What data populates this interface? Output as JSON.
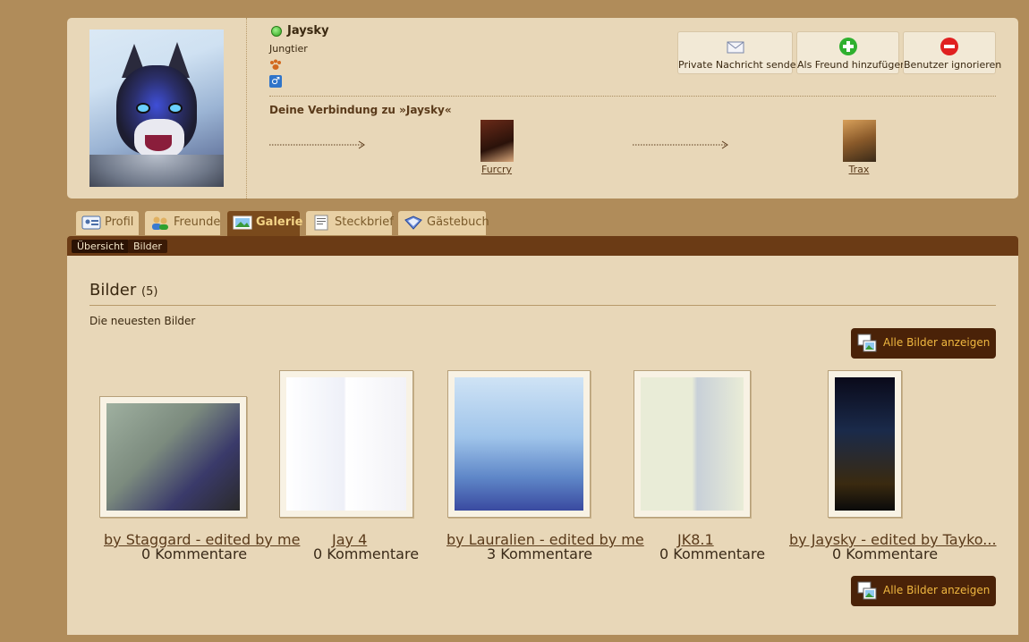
{
  "profile": {
    "username": "Jaysky",
    "rank": "Jungtier",
    "gender_symbol": "♂",
    "online_color": "#2aa31a"
  },
  "actions": {
    "private_message": "Private Nachricht senden",
    "add_friend": "Als Freund hinzufügen",
    "ignore_user": "Benutzer ignorieren"
  },
  "connection": {
    "title": "Deine Verbindung zu »Jaysky«",
    "people": [
      "Furcry",
      "Trax"
    ]
  },
  "tabs": [
    {
      "label": "Profil",
      "active": false
    },
    {
      "label": "Freunde",
      "active": false
    },
    {
      "label": "Galerie",
      "active": true
    },
    {
      "label": "Steckbrief",
      "active": false
    },
    {
      "label": "Gästebuch",
      "active": false
    }
  ],
  "subnav": {
    "overview": "Übersicht",
    "pictures": "Bilder"
  },
  "gallery": {
    "title": "Bilder",
    "count": "(5)",
    "subtitle": "Die neuesten Bilder",
    "all_button": "Alle Bilder anzeigen",
    "items": [
      {
        "title": "by Staggard - edited by me",
        "comments": "0 Kommentare"
      },
      {
        "title": "Jay 4",
        "comments": "0 Kommentare"
      },
      {
        "title": "by Lauralien - edited by me",
        "comments": "3 Kommentare"
      },
      {
        "title": "JK8.1",
        "comments": "0 Kommentare"
      },
      {
        "title": "by Jaysky - edited by Tayko...",
        "comments": "0 Kommentare"
      }
    ]
  }
}
